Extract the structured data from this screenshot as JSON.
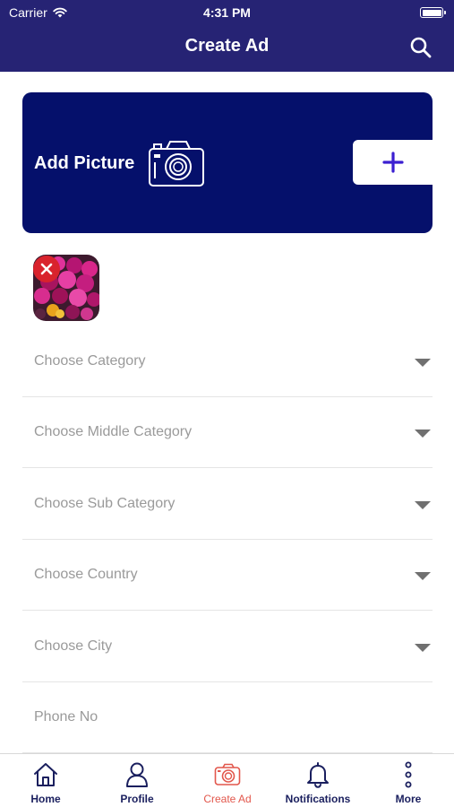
{
  "status_bar": {
    "carrier": "Carrier",
    "time": "4:31 PM"
  },
  "header": {
    "title": "Create Ad",
    "search_icon": "search-icon"
  },
  "add_picture": {
    "label": "Add Picture",
    "camera_icon": "camera-icon",
    "add_icon": "plus-icon"
  },
  "image_thumb": {
    "remove_icon": "close-icon"
  },
  "fields": [
    {
      "placeholder": "Choose Category",
      "dropdown": true
    },
    {
      "placeholder": "Choose Middle Category",
      "dropdown": true
    },
    {
      "placeholder": "Choose Sub Category",
      "dropdown": true
    },
    {
      "placeholder": "Choose Country",
      "dropdown": true
    },
    {
      "placeholder": "Choose City",
      "dropdown": true
    },
    {
      "placeholder": "Phone No",
      "dropdown": false
    }
  ],
  "tabs": [
    {
      "label": "Home",
      "icon": "home-icon",
      "active": false
    },
    {
      "label": "Profile",
      "icon": "user-icon",
      "active": false
    },
    {
      "label": "Create Ad",
      "icon": "camera-icon",
      "active": true
    },
    {
      "label": "Notifications",
      "icon": "bell-icon",
      "active": false
    },
    {
      "label": "More",
      "icon": "more-vertical-icon",
      "active": false
    }
  ],
  "colors": {
    "header_bg": "#262374",
    "card_bg": "#05106b",
    "accent": "#3b1fd1",
    "active_tab": "#e2574c",
    "tab_text": "#1a1f5e",
    "remove_badge": "#d9232d"
  }
}
